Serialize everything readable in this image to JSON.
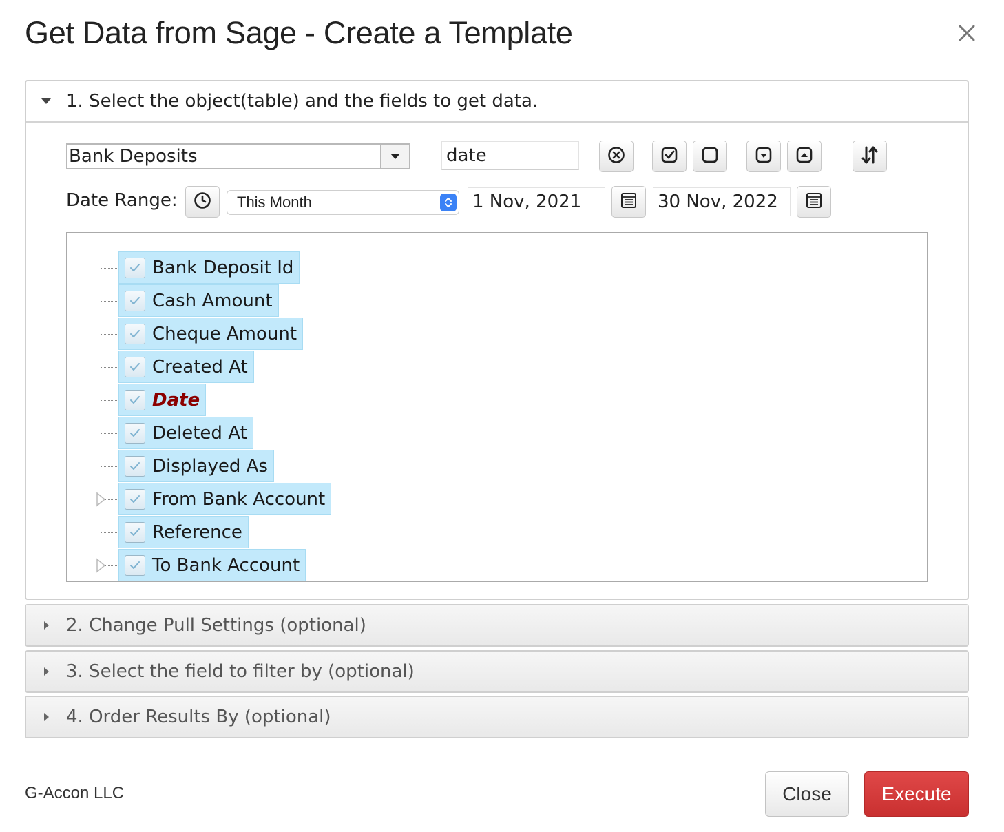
{
  "dialog": {
    "title": "Get Data from Sage - Create a Template"
  },
  "sections": [
    {
      "label": "1. Select the object(table) and the fields to get data.",
      "expanded": true
    },
    {
      "label": "2. Change Pull Settings (optional)",
      "expanded": false
    },
    {
      "label": "3. Select the field to filter by (optional)",
      "expanded": false
    },
    {
      "label": "4. Order Results By (optional)",
      "expanded": false
    }
  ],
  "object_select": {
    "value": "Bank Deposits"
  },
  "field_search": {
    "value": "date"
  },
  "toolbar_icons": [
    "clear-icon",
    "check-all-icon",
    "uncheck-all-icon",
    "expand-icon",
    "collapse-icon",
    "sort-icon"
  ],
  "date_range": {
    "label": "Date Range:",
    "preset": "This Month",
    "start": "1 Nov, 2021",
    "end": "30 Nov, 2022"
  },
  "fields": [
    {
      "label": "Bank Deposit Id",
      "checked": true,
      "highlight": false,
      "expandable": false
    },
    {
      "label": "Cash Amount",
      "checked": true,
      "highlight": false,
      "expandable": false
    },
    {
      "label": "Cheque Amount",
      "checked": true,
      "highlight": false,
      "expandable": false
    },
    {
      "label": "Created At",
      "checked": true,
      "highlight": false,
      "expandable": false
    },
    {
      "label": "Date",
      "checked": true,
      "highlight": true,
      "expandable": false
    },
    {
      "label": "Deleted At",
      "checked": true,
      "highlight": false,
      "expandable": false
    },
    {
      "label": "Displayed As",
      "checked": true,
      "highlight": false,
      "expandable": false
    },
    {
      "label": "From Bank Account",
      "checked": true,
      "highlight": false,
      "expandable": true
    },
    {
      "label": "Reference",
      "checked": true,
      "highlight": false,
      "expandable": false
    },
    {
      "label": "To Bank Account",
      "checked": true,
      "highlight": false,
      "expandable": true
    }
  ],
  "footer": {
    "brand": "G-Accon LLC",
    "close_label": "Close",
    "execute_label": "Execute"
  },
  "colors": {
    "node_bg": "#c2e9fb",
    "highlight_text": "#8b0000",
    "execute_bg": "#d33b3b"
  }
}
